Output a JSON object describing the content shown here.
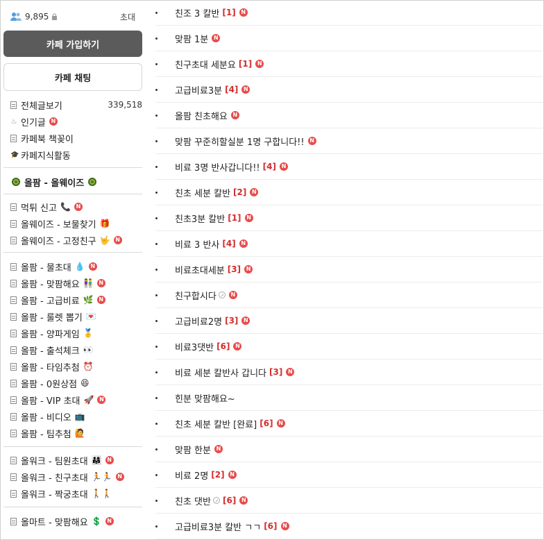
{
  "sidebar": {
    "member_count": "9,895",
    "invite_label": "초대",
    "join_button": "카페 가입하기",
    "chat_button": "카페 채팅",
    "top_menu": [
      {
        "label": "전체글보기",
        "count": "339,518",
        "icon": "board-icon"
      },
      {
        "label": "인기글",
        "icon": "fire-icon",
        "new": "N"
      },
      {
        "label": "카페북 책꽂이",
        "icon": "book-icon"
      },
      {
        "label": "카페지식활동",
        "icon": "graduation-icon"
      }
    ],
    "section_title": "올팜 - 올웨이즈",
    "group1": [
      {
        "label": "먹튀 신고",
        "emoji": "📞",
        "new": "N"
      },
      {
        "label": "올웨이즈 - 보물찾기",
        "emoji": "🎁"
      },
      {
        "label": "올웨이즈 - 고정친구",
        "emoji": "🤟",
        "new": "N"
      }
    ],
    "group2": [
      {
        "label": "올팜 - 물초대",
        "emoji": "💧",
        "new": "N"
      },
      {
        "label": "올팜 - 맞팜해요",
        "emoji": "👫",
        "new": "N"
      },
      {
        "label": "올팜 - 고급비료",
        "emoji": "🌿",
        "new": "N"
      },
      {
        "label": "올팜 - 룰렛 뽑기",
        "emoji": "💌"
      },
      {
        "label": "올팜 - 양파게임",
        "emoji": "🥇"
      },
      {
        "label": "올팜 - 출석체크",
        "emoji": "👀"
      },
      {
        "label": "올팜 - 타임추첨",
        "emoji": "⏰"
      },
      {
        "label": "올팜 - 0원상점",
        "emoji": "😆"
      },
      {
        "label": "올팜 - VIP 초대",
        "emoji": "🚀",
        "new": "N"
      },
      {
        "label": "올팜 - 비디오",
        "emoji": "📺"
      },
      {
        "label": "올팜 - 팀추첨",
        "emoji": "🙋"
      }
    ],
    "group3": [
      {
        "label": "올워크 - 팀원초대",
        "emoji": "👨‍👩‍👧",
        "new": "N"
      },
      {
        "label": "올워크 - 친구초대",
        "emoji": "🏃🏃",
        "new": "N"
      },
      {
        "label": "올워크 - 짝궁초대",
        "emoji": "🚶🚶"
      }
    ],
    "group4": [
      {
        "label": "올마트 - 맞팜해요",
        "emoji": "💲",
        "new": "N"
      }
    ],
    "accent_color": "#e84c4c",
    "join_button_color": "#5b5b5b"
  },
  "posts": [
    {
      "title": "친조 3 칼반",
      "replies": "[1]",
      "new": "N"
    },
    {
      "title": "맞팜 1분",
      "replies": "",
      "new": "N"
    },
    {
      "title": "친구초대 세분요",
      "replies": "[1]",
      "new": "N"
    },
    {
      "title": "고급비료3분",
      "replies": "[4]",
      "new": "N"
    },
    {
      "title": "올팜 친초해요",
      "replies": "",
      "new": "N"
    },
    {
      "title": "맞팜 꾸준히할실분 1명 구합니다!!",
      "replies": "",
      "new": "N"
    },
    {
      "title": "비료 3명 반사갑니다!!",
      "replies": "[4]",
      "new": "N"
    },
    {
      "title": "친초 세분 칼반",
      "replies": "[2]",
      "new": "N"
    },
    {
      "title": "친초3분 칼반",
      "replies": "[1]",
      "new": "N"
    },
    {
      "title": "비료 3 반사",
      "replies": "[4]",
      "new": "N"
    },
    {
      "title": "비료초대세분",
      "replies": "[3]",
      "new": "N"
    },
    {
      "title": "친구합시다",
      "replies": "",
      "image": true,
      "new": "N"
    },
    {
      "title": "고급비료2명",
      "replies": "[3]",
      "new": "N"
    },
    {
      "title": "비료3댓반",
      "replies": "[6]",
      "new": "N"
    },
    {
      "title": "비료 세분 칼반사 갑니다",
      "replies": "[3]",
      "new": "N"
    },
    {
      "title": "힌분 맞팜해요~",
      "replies": "",
      "new": ""
    },
    {
      "title": "친초 세분 칼반 [완료]",
      "replies": "[6]",
      "new": "N"
    },
    {
      "title": "맞팜 한분",
      "replies": "",
      "new": "N"
    },
    {
      "title": "비료 2명",
      "replies": "[2]",
      "new": "N"
    },
    {
      "title": "친초 댓반",
      "replies": "[6]",
      "image": true,
      "new": "N"
    },
    {
      "title": "고급비료3분 칼반 ㄱㄱ",
      "replies": "[6]",
      "new": "N"
    }
  ]
}
